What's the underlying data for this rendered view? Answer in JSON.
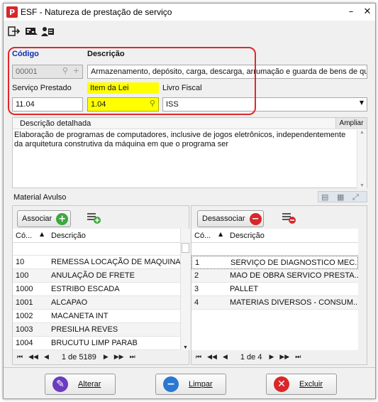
{
  "window": {
    "title": "ESF - Natureza de prestação de serviço",
    "app_icon": "P"
  },
  "toolbar": {
    "icons": [
      "exit-icon",
      "card-icon",
      "users-icon"
    ]
  },
  "form": {
    "codigo_label": "Código",
    "codigo_value": "00001",
    "descricao_label": "Descrição",
    "descricao_value": "Armazenamento, depósito, carga, descarga, arrumação e guarda de bens de qu",
    "servico_label": "Serviço Prestado",
    "servico_value": "11.04",
    "item_lei_label": "Item da Lei",
    "item_lei_value": "1.04",
    "livro_label": "Livro Fiscal",
    "livro_value": "ISS"
  },
  "detail": {
    "header": "Descrição detalhada",
    "ampliar": "Ampliar",
    "text": "Elaboração de programas de computadores, inclusive de jogos eletrônicos, independentemente da arquitetura construtiva da máquina em que o programa ser"
  },
  "material": {
    "title": "Material Avulso",
    "associar": "Associar",
    "desassociar": "Desassociar",
    "left_cols": [
      "Có...",
      "Descrição"
    ],
    "right_cols": [
      "Có...",
      "Descrição"
    ],
    "left_rows": [
      {
        "code": "10",
        "desc": "REMESSA LOCAÇÃO DE MAQUINAS"
      },
      {
        "code": "100",
        "desc": "ANULAÇÃO DE FRETE"
      },
      {
        "code": "1000",
        "desc": "ESTRIBO ESCADA"
      },
      {
        "code": "1001",
        "desc": "ALCAPAO"
      },
      {
        "code": "1002",
        "desc": "MACANETA INT"
      },
      {
        "code": "1003",
        "desc": "PRESILHA REVES"
      },
      {
        "code": "1004",
        "desc": "BRUCUTU LIMP PARAB"
      }
    ],
    "right_rows": [
      {
        "code": "1",
        "desc": "SERVIÇO DE DIAGNOSTICO MEC..."
      },
      {
        "code": "2",
        "desc": "MAO DE OBRA SERVICO PRESTA..."
      },
      {
        "code": "3",
        "desc": "PALLET"
      },
      {
        "code": "4",
        "desc": "MATERIAS DIVERSOS - CONSUM..."
      }
    ],
    "left_pager": "1 de 5189",
    "right_pager": "1 de 4"
  },
  "footer": {
    "alterar": "Alterar",
    "limpar": "Limpar",
    "excluir": "Excluir"
  },
  "colors": {
    "accent_red": "#e0282c",
    "highlight_yellow": "#ffff00",
    "label_blue": "#0a2db0"
  }
}
